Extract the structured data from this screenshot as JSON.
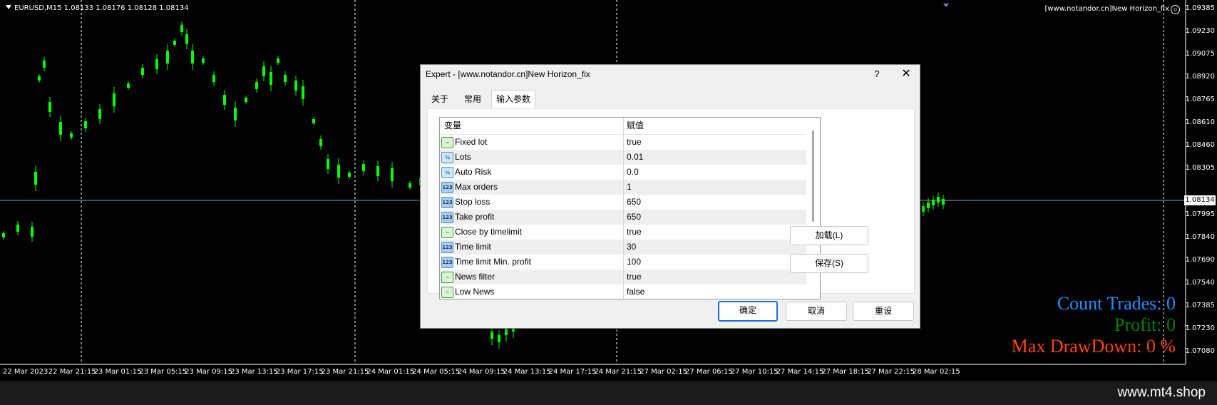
{
  "chart": {
    "symbol_info": "EURUSD,M15  1.08133 1.08176 1.08128 1.08134",
    "ea_name": "[www.notandor.cn]New Horizon_fix",
    "current_price": "1.08134",
    "y_axis_labels": [
      "1.09385",
      "1.09230",
      "1.09075",
      "1.08920",
      "1.08765",
      "1.08610",
      "1.08460",
      "1.08305",
      "1.07995",
      "1.07840",
      "1.07690",
      "1.07540",
      "1.07385",
      "1.07230",
      "1.07080"
    ],
    "x_axis_labels": [
      "22 Mar 2023",
      "22 Mar 21:15",
      "23 Mar 01:15",
      "23 Mar 05:15",
      "23 Mar 09:15",
      "23 Mar 13:15",
      "23 Mar 17:15",
      "23 Mar 21:15",
      "24 Mar 01:15",
      "24 Mar 05:15",
      "24 Mar 09:15",
      "24 Mar 13:15",
      "24 Mar 17:15",
      "24 Mar 21:15",
      "27 Mar 02:15",
      "27 Mar 06:15",
      "27 Mar 10:15",
      "27 Mar 14:15",
      "27 Mar 18:15",
      "27 Mar 22:15",
      "28 Mar 02:15"
    ],
    "stats": {
      "count_trades": "Count Trades: 0",
      "profit": "Profit: 0",
      "max_drawdown": "Max DrawDown: 0 %"
    },
    "colors": {
      "candle": "#00ff00",
      "price_line": "#8aa6c8",
      "background": "#000000"
    }
  },
  "watermark": "www.mt4.shop",
  "dialog": {
    "title": "Expert - [www.notandor.cn]New Horizon_fix",
    "help_label": "?",
    "close_label": "✕",
    "tabs": [
      {
        "label": "关于"
      },
      {
        "label": "常用"
      },
      {
        "label": "输入参数",
        "active": true
      }
    ],
    "table": {
      "col_variable": "变量",
      "col_value": "赋值",
      "rows": [
        {
          "name": "Fixed lot",
          "value": "true",
          "type": "bool"
        },
        {
          "name": "Lots",
          "value": "0.01",
          "type": "double"
        },
        {
          "name": "Auto Risk",
          "value": "0.0",
          "type": "double"
        },
        {
          "name": "Max orders",
          "value": "1",
          "type": "int"
        },
        {
          "name": "Stop loss",
          "value": "650",
          "type": "int"
        },
        {
          "name": "Take profit",
          "value": "650",
          "type": "int"
        },
        {
          "name": "Close by timelimit",
          "value": "true",
          "type": "bool"
        },
        {
          "name": "Time limit",
          "value": "30",
          "type": "int"
        },
        {
          "name": "Time limit Min. profit",
          "value": "100",
          "type": "int"
        },
        {
          "name": "News filter",
          "value": "true",
          "type": "bool"
        },
        {
          "name": "Low News",
          "value": "false",
          "type": "bool"
        }
      ]
    },
    "buttons": {
      "load": "加载(L)",
      "save": "保存(S)",
      "ok": "确定",
      "cancel": "取消",
      "reset": "重设"
    }
  }
}
